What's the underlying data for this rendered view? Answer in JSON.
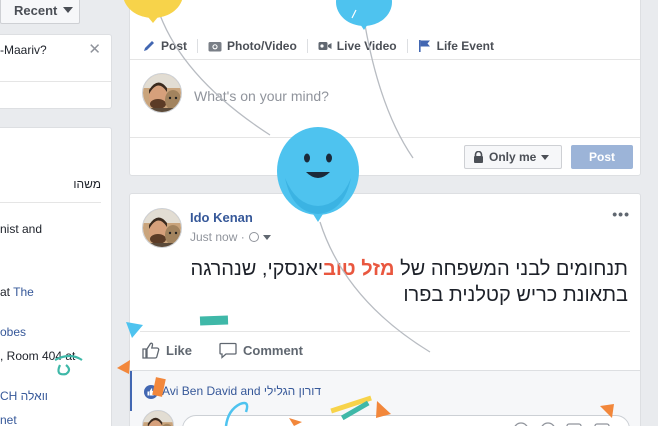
{
  "left": {
    "recent_label": "Recent",
    "question": "-Maariv?",
    "close": "✕",
    "items": [
      {
        "text": "משהו"
      },
      {
        "text": "nist and"
      },
      {
        "text": "at ",
        "link": "The"
      },
      {
        "text": "obes"
      },
      {
        "text": ", Room 404 at"
      },
      {
        "text": "CH וואלה"
      },
      {
        "text": "net"
      }
    ]
  },
  "composer": {
    "actions": {
      "post": "Post",
      "photo_video": "Photo/Video",
      "live_video": "Live Video",
      "life_event": "Life Event"
    },
    "placeholder": "What's on your mind?",
    "audience": "Only me",
    "post_button": "Post"
  },
  "post": {
    "author": "Ido Kenan",
    "time": "Just now ·",
    "menu": "•••",
    "text_before": "תנחומים לבני המשפחה של ",
    "text_highlight": "מזל טוב",
    "text_after": "יאנסקי, שנהרגה בתאונת כריש קטלנית בפרו",
    "like": "Like",
    "comment": "Comment",
    "likers_name": "Avi Ben David",
    "likers_and": " and ",
    "likers_other": "דורון הגלילי"
  },
  "colors": {
    "fb_blue": "#4267b2",
    "link": "#365899",
    "highlight": "#e9573f",
    "balloon_blue": "#4ec3ef",
    "balloon_yellow": "#f7d34a"
  }
}
